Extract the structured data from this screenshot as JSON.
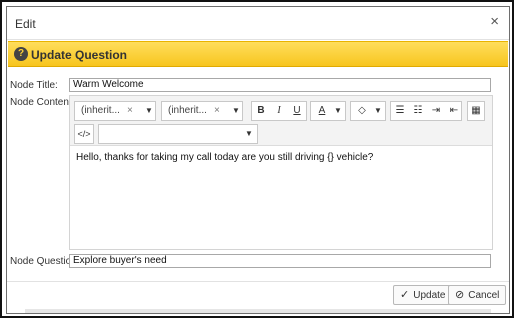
{
  "dialog": {
    "title": "Edit",
    "close_symbol": "×"
  },
  "banner": {
    "icon_symbol": "?",
    "title": "Update Question"
  },
  "form": {
    "node_title_label": "Node Title:",
    "node_title_value": "Warm Welcome",
    "node_content_label": "Node Content:",
    "node_question_label": "Node Question",
    "node_question_value": "Explore buyer's need"
  },
  "editor": {
    "font_family": "(inherit...",
    "font_size": "(inherit...",
    "clear_symbol": "×",
    "arrow_symbol": "▼",
    "bold": "B",
    "italic": "I",
    "underline": "U",
    "font_color": "A",
    "highlight": "◇",
    "list_bullet": "☰",
    "list_number": "☷",
    "indent": "⇥",
    "outdent": "⇤",
    "table": "▦",
    "source": "</>",
    "format_value": "",
    "content": "Hello, thanks for taking my call today are you still driving {} vehicle?"
  },
  "footer": {
    "update_icon": "✓",
    "update_label": "Update",
    "cancel_icon": "⊘",
    "cancel_label": "Cancel"
  }
}
